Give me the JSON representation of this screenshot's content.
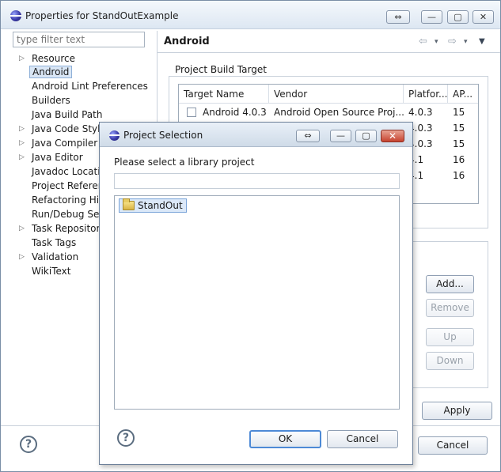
{
  "window": {
    "title": "Properties for StandOutExample",
    "buttons": {
      "restore": "⇔",
      "minimize": "—",
      "maximize": "▢",
      "close": "✕"
    }
  },
  "sidebar": {
    "filter_placeholder": "type filter text",
    "items": [
      {
        "label": "Resource",
        "expandable": true
      },
      {
        "label": "Android",
        "expandable": false,
        "selected": true
      },
      {
        "label": "Android Lint Preferences",
        "expandable": false
      },
      {
        "label": "Builders",
        "expandable": false
      },
      {
        "label": "Java Build Path",
        "expandable": false
      },
      {
        "label": "Java Code Style",
        "expandable": true
      },
      {
        "label": "Java Compiler",
        "expandable": true
      },
      {
        "label": "Java Editor",
        "expandable": true
      },
      {
        "label": "Javadoc Location",
        "expandable": false
      },
      {
        "label": "Project References",
        "expandable": false
      },
      {
        "label": "Refactoring History",
        "expandable": false
      },
      {
        "label": "Run/Debug Settings",
        "expandable": false
      },
      {
        "label": "Task Repository",
        "expandable": true
      },
      {
        "label": "Task Tags",
        "expandable": false
      },
      {
        "label": "Validation",
        "expandable": true
      },
      {
        "label": "WikiText",
        "expandable": false
      }
    ]
  },
  "page": {
    "title": "Android",
    "nav": {
      "back": "⇦",
      "forward": "⇨",
      "dropdown": "▾",
      "menu": "▼"
    },
    "build_target": {
      "group_label": "Project Build Target",
      "columns": [
        "Target Name",
        "Vendor",
        "Platfor...",
        "AP..."
      ],
      "rows": [
        {
          "name": "Android 4.0.3",
          "vendor": "Android Open Source Proj...",
          "platform": "4.0.3",
          "api": "15"
        },
        {
          "name": "",
          "vendor": "",
          "platform": "4.0.3",
          "api": "15"
        },
        {
          "name": "",
          "vendor": "",
          "platform": "4.0.3",
          "api": "15"
        },
        {
          "name": "",
          "vendor": "",
          "platform": "4.1",
          "api": "16"
        },
        {
          "name": "",
          "vendor": "",
          "platform": "4.1",
          "api": "16"
        }
      ]
    },
    "library": {
      "add": "Add...",
      "remove": "Remove",
      "up": "Up",
      "down": "Down"
    },
    "apply": "Apply",
    "cancel": "Cancel",
    "help": "?"
  },
  "dialog": {
    "title": "Project Selection",
    "buttons": {
      "restore": "⇔",
      "minimize": "—",
      "maximize": "▢",
      "close": "✕"
    },
    "prompt": "Please select a library project",
    "filter_value": "",
    "projects": [
      "StandOut"
    ],
    "ok": "OK",
    "cancel": "Cancel",
    "help": "?"
  }
}
